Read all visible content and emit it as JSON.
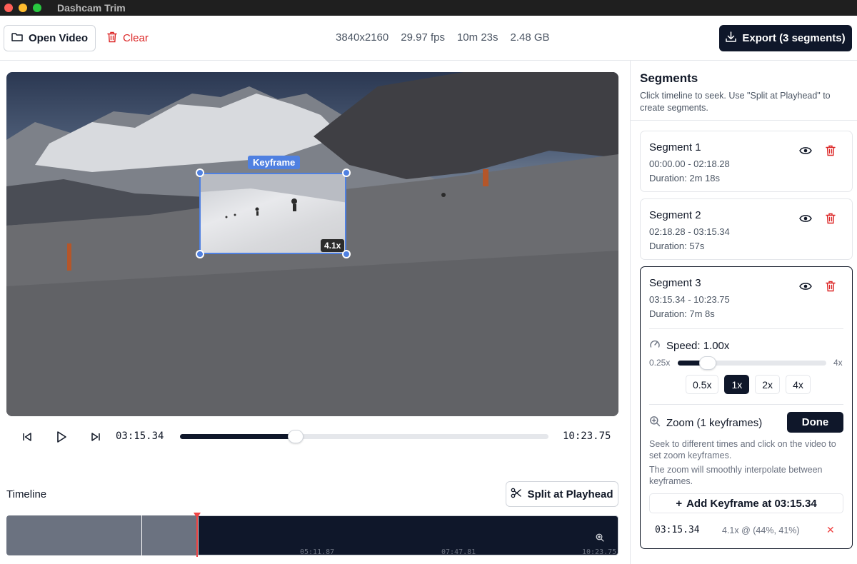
{
  "app": {
    "title": "Dashcam Trim"
  },
  "toolbar": {
    "open_label": "Open Video",
    "clear_label": "Clear",
    "resolution": "3840x2160",
    "fps": "29.97 fps",
    "duration": "10m 23s",
    "size": "2.48 GB",
    "export_label": "Export (3 segments)"
  },
  "video": {
    "keyframe_label": "Keyframe",
    "zoom_badge": "4.1x"
  },
  "playback": {
    "current_time": "03:15.34",
    "end_time": "10:23.75",
    "progress": 0.313
  },
  "timeline": {
    "label": "Timeline",
    "split_label": "Split at Playhead",
    "ticks": [
      "05:11.87",
      "07:47.81",
      "10:23.75"
    ]
  },
  "sidebar": {
    "title": "Segments",
    "description": "Click timeline to seek. Use \"Split at Playhead\" to create segments.",
    "segments": [
      {
        "title": "Segment 1",
        "range": "00:00.00 - 02:18.28",
        "duration": "Duration: 2m 18s"
      },
      {
        "title": "Segment 2",
        "range": "02:18.28 - 03:15.34",
        "duration": "Duration: 57s"
      },
      {
        "title": "Segment 3",
        "range": "03:15.34 - 10:23.75",
        "duration": "Duration: 7m 8s"
      }
    ],
    "speed": {
      "label": "Speed: 1.00x",
      "min": "0.25x",
      "max": "4x",
      "value_fraction": 0.2,
      "presets": [
        "0.5x",
        "1x",
        "2x",
        "4x"
      ],
      "selected": "1x"
    },
    "zoom": {
      "label": "Zoom (1 keyframes)",
      "done_label": "Done",
      "help1": "Seek to different times and click on the video to set zoom keyframes.",
      "help2": "The zoom will smoothly interpolate between keyframes.",
      "add_label": "Add Keyframe at 03:15.34",
      "add_prefix": "+",
      "keyframes": [
        {
          "time": "03:15.34",
          "value": "4.1x @ (44%, 41%)"
        }
      ]
    }
  },
  "colors": {
    "accent": "#0f172a",
    "danger": "#dc2626",
    "keyframe": "#4f80e1"
  }
}
